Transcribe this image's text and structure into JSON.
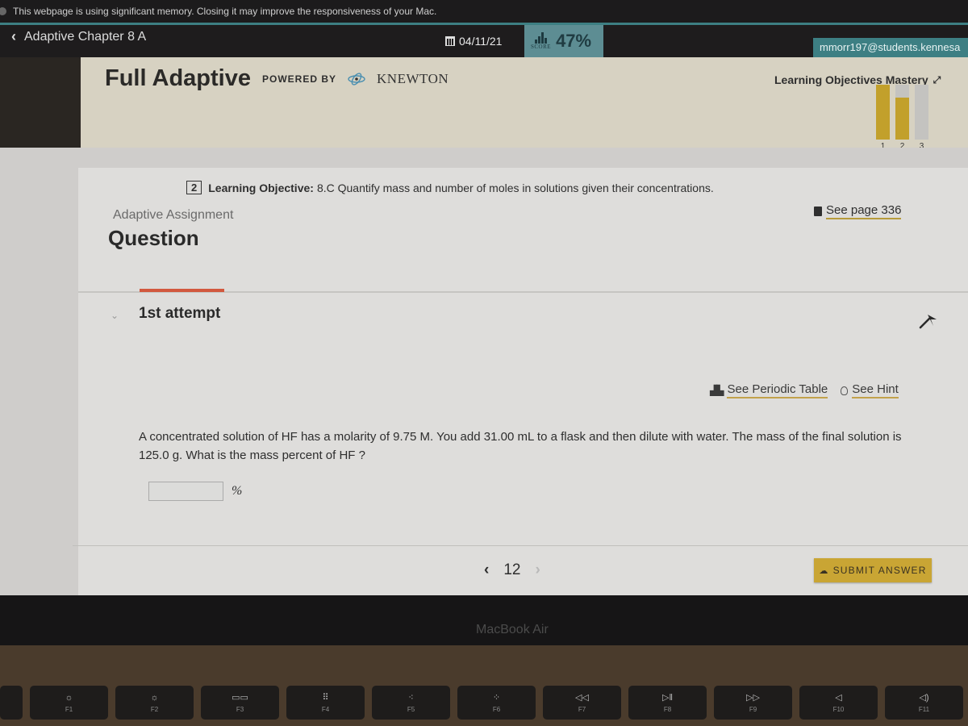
{
  "system_banner": "This webpage is using significant memory. Closing it may improve the responsiveness of your Mac.",
  "topbar": {
    "back_label": "Adaptive Chapter 8 A",
    "date": "04/11/21",
    "score_icon_label": "SCORE",
    "score": "47%",
    "user_email": "mmorr197@students.kennesa"
  },
  "header": {
    "title": "Full Adaptive",
    "powered_by": "POWERED BY",
    "partner": "KNEWTON",
    "mastery_title": "Learning Objectives Mastery",
    "mastery": [
      {
        "label": "1",
        "fill": 1.0
      },
      {
        "label": "2",
        "fill": 0.77
      },
      {
        "label": "3",
        "fill": 0.0
      }
    ]
  },
  "colors": {
    "accent_gold": "#c9a534",
    "attempt_tab": "#d2583e",
    "teal": "#3d7f83"
  },
  "question": {
    "objective_number": "2",
    "objective_label": "Learning Objective:",
    "objective_text": "8.C Quantify mass and number of moles in solutions given their concentrations.",
    "see_page": "See page 336",
    "assignment_label": "Adaptive Assignment",
    "title": "Question",
    "attempt_label": "1st attempt",
    "periodic_table_link": "See Periodic Table",
    "hint_link": "See Hint",
    "text": "A concentrated solution of HF has a molarity of 9.75 M. You add 31.00 mL to a flask and then dilute with water. The mass of the final solution is 125.0 g. What is the mass percent of HF ?",
    "answer_value": "",
    "answer_unit": "%",
    "page_number": "12",
    "submit_label": "SUBMIT ANSWER"
  },
  "device": {
    "label": "MacBook Air",
    "keys": [
      "",
      "F1",
      "F2",
      "F3",
      "F4",
      "F5",
      "F6",
      "F7",
      "F8",
      "F9",
      "F10",
      "F11"
    ],
    "key_glyphs": [
      "",
      "☼",
      "☼",
      "▭▭",
      "⠿",
      "⁖",
      "⁘",
      "◁◁",
      "▷‖",
      "▷▷",
      "◁",
      "◁)"
    ]
  }
}
